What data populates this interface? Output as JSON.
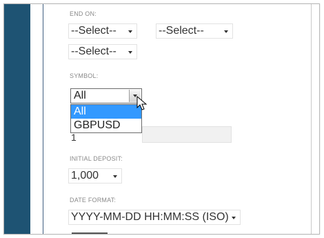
{
  "form": {
    "end_on": {
      "label": "END ON:",
      "select1": "--Select--",
      "select2": "--Select--",
      "select3": "--Select--"
    },
    "symbol": {
      "label": "SYMBOL:",
      "value": "All",
      "options": [
        "All",
        "GBPUSD"
      ]
    },
    "input_partial_value": "1",
    "initial_deposit": {
      "label": "INITIAL DEPOSIT:",
      "value": "1,000"
    },
    "date_format": {
      "label": "DATE FORMAT:",
      "value": "YYYY-MM-DD HH:MM:SS (ISO)"
    }
  },
  "colors": {
    "sidebar": "#1e5373",
    "highlight": "#3399ff"
  }
}
